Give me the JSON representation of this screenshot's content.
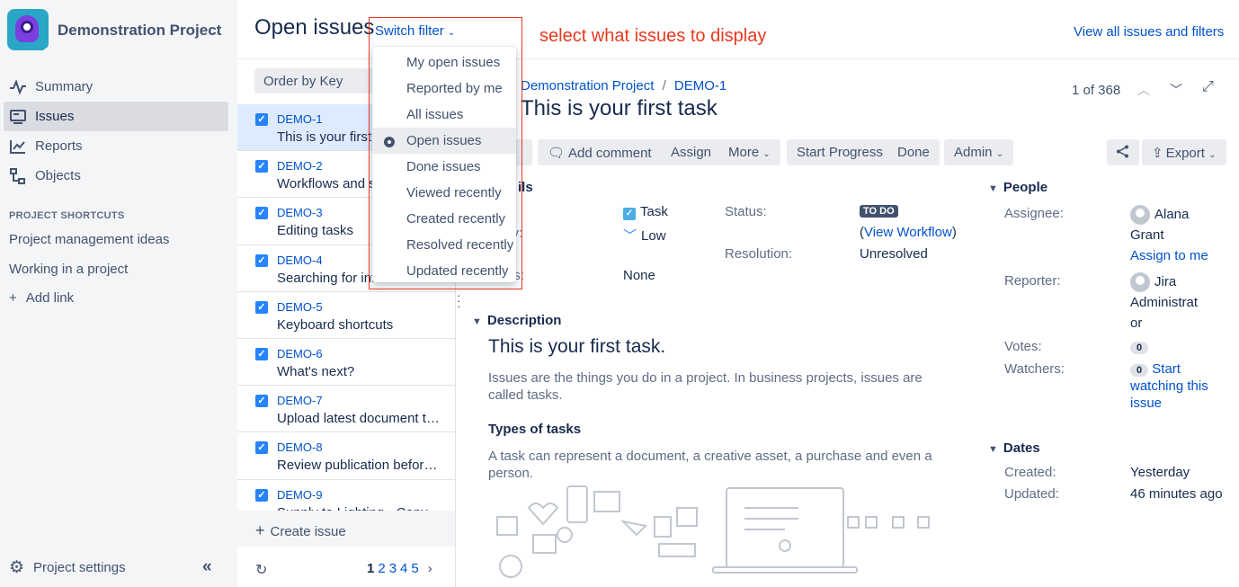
{
  "sidebar": {
    "project_name": "Demonstration Project",
    "nav": [
      {
        "label": "Summary",
        "icon": "pulse-icon"
      },
      {
        "label": "Issues",
        "icon": "issues-icon",
        "active": true
      },
      {
        "label": "Reports",
        "icon": "chart-icon"
      },
      {
        "label": "Objects",
        "icon": "tree-icon"
      }
    ],
    "shortcuts_title": "PROJECT SHORTCUTS",
    "shortcuts": [
      "Project management ideas",
      "Working in a project"
    ],
    "add_link": "Add link",
    "settings": "Project settings"
  },
  "header": {
    "title": "Open issues",
    "switch_filter": "Switch filter",
    "annotation": "select what issues to display",
    "view_all": "View all issues and filters"
  },
  "list": {
    "order_by": "Order by Key",
    "issues": [
      {
        "key": "DEMO-1",
        "summary": "This is your first task"
      },
      {
        "key": "DEMO-2",
        "summary": "Workflows and statuses"
      },
      {
        "key": "DEMO-3",
        "summary": "Editing tasks"
      },
      {
        "key": "DEMO-4",
        "summary": "Searching for information"
      },
      {
        "key": "DEMO-5",
        "summary": "Keyboard shortcuts"
      },
      {
        "key": "DEMO-6",
        "summary": "What's next?"
      },
      {
        "key": "DEMO-7",
        "summary": "Upload latest document to..."
      },
      {
        "key": "DEMO-8",
        "summary": "Review publication before ..."
      },
      {
        "key": "DEMO-9",
        "summary": "Supply to Lighting - Copy"
      }
    ],
    "create_issue": "Create issue",
    "pages": [
      "1",
      "2",
      "3",
      "4",
      "5"
    ]
  },
  "dropdown": {
    "items": [
      "My open issues",
      "Reported by me",
      "All issues",
      "Open issues",
      "Done issues",
      "Viewed recently",
      "Created recently",
      "Resolved recently",
      "Updated recently"
    ],
    "selected": "Open issues"
  },
  "issue": {
    "breadcrumb_project": "Demonstration Project",
    "breadcrumb_sep": "/",
    "breadcrumb_key": "DEMO-1",
    "title": "This is your first task",
    "counter": "1 of 368",
    "toolbar": {
      "edit": "t",
      "add_comment": "Add comment",
      "assign": "Assign",
      "more": "More",
      "start_progress": "Start Progress",
      "done": "Done",
      "admin": "Admin",
      "export": "Export"
    },
    "details": {
      "section": "ils",
      "type_label": ":",
      "type_value": "Task",
      "priority_label": "ity:",
      "priority_value": "Low",
      "labels_label": "ls:",
      "labels_value": "None",
      "status_label": "Status:",
      "status_value": "TO DO",
      "view_workflow_open": "(",
      "view_workflow": "View Workflow",
      "view_workflow_close": ")",
      "resolution_label": "Resolution:",
      "resolution_value": "Unresolved"
    },
    "description": {
      "section": "Description",
      "heading": "This is your first task.",
      "para1": "Issues are the things you do in a project. In business projects, issues are called tasks.",
      "types_heading": "Types of tasks",
      "para2": "A task can represent a document, a creative asset, a purchase and even a person."
    },
    "people": {
      "section": "People",
      "assignee_label": "Assignee:",
      "assignee_line1": "Alana",
      "assignee_line2": "Grant",
      "assign_to_me": "Assign to me",
      "reporter_label": "Reporter:",
      "reporter_line1": "Jira",
      "reporter_line2": "Administrat",
      "reporter_line3": "or",
      "votes_label": "Votes:",
      "votes": "0",
      "watchers_label": "Watchers:",
      "watchers": "0",
      "watch_line1": "Start",
      "watch_line2": "watching this",
      "watch_line3": "issue"
    },
    "dates": {
      "section": "Dates",
      "created_label": "Created:",
      "created": "Yesterday",
      "updated_label": "Updated:",
      "updated": "46 minutes ago"
    }
  },
  "colors": {
    "accent": "#0052cc",
    "annotation": "#e8391f",
    "sidebar_bg": "#f4f5f7",
    "selected_row": "#deebff"
  }
}
